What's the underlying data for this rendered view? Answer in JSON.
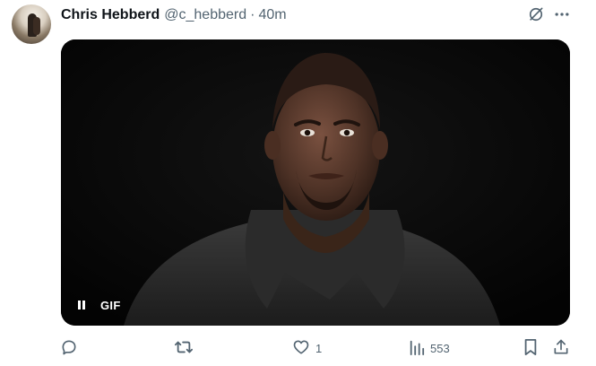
{
  "tweet": {
    "author_name": "Chris Hebberd",
    "author_handle": "@c_hebberd",
    "separator": "·",
    "timestamp": "40m",
    "media": {
      "type": "gif",
      "badge": "GIF",
      "state": "playing"
    },
    "actions": {
      "reply_count": "",
      "retweet_count": "",
      "like_count": "1",
      "views_count": "553"
    }
  },
  "icons": {
    "grok": "grok-icon",
    "more": "more-icon",
    "pause": "pause-icon",
    "reply": "reply-icon",
    "retweet": "retweet-icon",
    "like": "like-icon",
    "views": "views-icon",
    "bookmark": "bookmark-icon",
    "share": "share-icon"
  },
  "colors": {
    "text_primary": "#0f1419",
    "text_secondary": "#536471",
    "media_bg": "#050505"
  }
}
